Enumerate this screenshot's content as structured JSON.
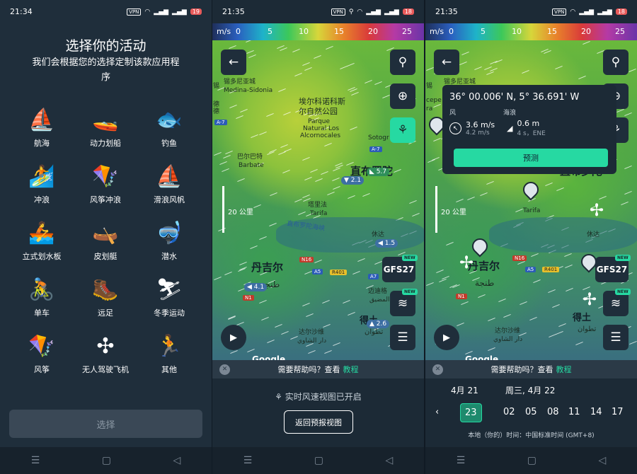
{
  "screen1": {
    "time": "21:34",
    "battery": "19",
    "vpn": "VPN",
    "title": "选择你的活动",
    "subtitle": "我们会根据您的选择定制该款应用程序",
    "activities": [
      {
        "label": "航海",
        "icon": "sailboat-icon",
        "glyph": "⛵"
      },
      {
        "label": "动力划船",
        "icon": "motorboat-icon",
        "glyph": "🚤"
      },
      {
        "label": "钓鱼",
        "icon": "fish-icon",
        "glyph": "🐟"
      },
      {
        "label": "冲浪",
        "icon": "surfer-icon",
        "glyph": "🏄"
      },
      {
        "label": "风筝冲浪",
        "icon": "kitesurf-icon",
        "glyph": "🪁"
      },
      {
        "label": "滑浪风帆",
        "icon": "windsurf-icon",
        "glyph": "⛵"
      },
      {
        "label": "立式划水板",
        "icon": "paddleboard-icon",
        "glyph": "🚣"
      },
      {
        "label": "皮划艇",
        "icon": "kayak-icon",
        "glyph": "🛶"
      },
      {
        "label": "潜水",
        "icon": "diving-icon",
        "glyph": "🤿"
      },
      {
        "label": "单车",
        "icon": "bike-icon",
        "glyph": "🚴"
      },
      {
        "label": "远足",
        "icon": "hiking-icon",
        "glyph": "🥾"
      },
      {
        "label": "冬季运动",
        "icon": "ski-icon",
        "glyph": "⛷"
      },
      {
        "label": "风筝",
        "icon": "kite-icon",
        "glyph": "🪁"
      },
      {
        "label": "无人驾驶飞机",
        "icon": "drone-icon",
        "glyph": "✣"
      },
      {
        "label": "其他",
        "icon": "runner-icon",
        "glyph": "🏃"
      }
    ],
    "select_button": "选择"
  },
  "screen2": {
    "time": "21:35",
    "battery": "18",
    "vpn": "VPN",
    "scale_unit": "m/s",
    "scale_values": [
      "0",
      "5",
      "10",
      "15",
      "20",
      "25"
    ],
    "places": {
      "medina": "锡多尼亚城",
      "medina_en": "Medina-Sidonia",
      "park": "埃尔科诺科斯",
      "park2": "尔自然公园",
      "park_en": "Parque",
      "park_en2": "Natural Los",
      "park_en3": "Alcornocales",
      "barbate": "巴尔巴特",
      "barbate_en": "Barbate",
      "sotogr": "Sotogr",
      "gibraltar": "直布罗陀",
      "tarifa": "塔里法",
      "tarifa_en": "Tarifa",
      "strait": "直布罗陀海峡",
      "tangier": "丹吉尔",
      "tangier_ar": "طنجة",
      "ceuta": "休达",
      "fnideq": "迈迪格",
      "fnideq_ar": "المضيق",
      "tetouan": "得土",
      "tetouan_ar": "تطوان",
      "daralshawi": "达尔沙维",
      "daralshawi_ar": "دار الشاوي",
      "left_edge": "锡",
      "left_edge2": "德",
      "left_edge3": "德",
      "left_edge4": "cepe",
      "left_edge5": "ra"
    },
    "roads": [
      "A-7",
      "N16",
      "A5",
      "R401",
      "A7",
      "N1"
    ],
    "wind_tags": [
      "2.1",
      "5.7",
      "1.5",
      "4.1",
      "2.6"
    ],
    "scale_label": "20 公里",
    "model_button": "GFS27",
    "new_badge": "NEW",
    "google": "Google",
    "help_text": "需要帮助吗？查看",
    "help_link": "教程",
    "live_message": "实时风速视图已开启",
    "back_button": "返回预报视图"
  },
  "screen3": {
    "time": "21:35",
    "battery": "18",
    "vpn": "VPN",
    "popup": {
      "coords": "36° 00.006' N, 5° 36.691' W",
      "wind_label": "风",
      "wave_label": "海浪",
      "wind_value": "3.6 m/s",
      "wind_sub": "4.2 m/s",
      "wave_value": "0.6 m",
      "wave_sub": "4 s，ENE",
      "forecast_button": "预测"
    },
    "date_prev": "4月 21",
    "date_current": "周三, 4月 22",
    "hours": [
      "23",
      "02",
      "05",
      "08",
      "11",
      "14",
      "17"
    ],
    "timezone": "本地（你的）时间：中国标准时间 (GMT+8)"
  }
}
